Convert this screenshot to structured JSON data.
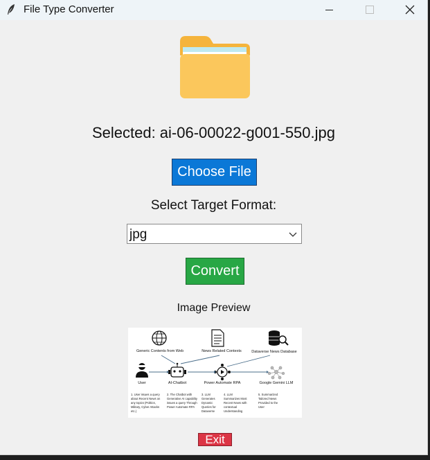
{
  "window": {
    "title": "File Type Converter",
    "icon": "feather-icon"
  },
  "file": {
    "selected_text": "Selected: ai-06-00022-g001-550.jpg",
    "choose_label": "Choose File",
    "folder_icon": "folder-icon"
  },
  "format": {
    "label": "Select Target Format:",
    "selected": "jpg"
  },
  "actions": {
    "convert_label": "Convert",
    "exit_label": "Exit"
  },
  "preview": {
    "label": "Image Preview",
    "image": {
      "nodes": {
        "web": "Generic Contents from Web",
        "news": "News Related Contexts",
        "db": "Dataverse News Database",
        "user": "User",
        "chatbot": "AI-Chatbot",
        "rpa": "Power Automate RPA",
        "llm": "Google Gemini LLM"
      },
      "steps": [
        [
          "1. User issues a query",
          "about Recent News on",
          "any topics (Politics,",
          "Military, Cyber Attacks",
          "etc.)"
        ],
        [
          "2. The Chatbot with",
          "Generative AI  capability",
          "issues a query Through",
          "Power Automate RPA"
        ],
        [
          "3. LLM",
          "Generates",
          "Dynamic",
          "Queries for",
          "Dataverse"
        ],
        [
          "4. LLM",
          "Summarizes Most",
          "Recent News with",
          "contextual",
          "Understanding"
        ],
        [
          "5. Summarized",
          "Tailored News",
          "Provided to the",
          "User"
        ]
      ]
    }
  },
  "colors": {
    "choose_button": "#0b78d7",
    "convert_button": "#28a745",
    "exit_button": "#dc3545",
    "folder": "#fbc75c"
  }
}
